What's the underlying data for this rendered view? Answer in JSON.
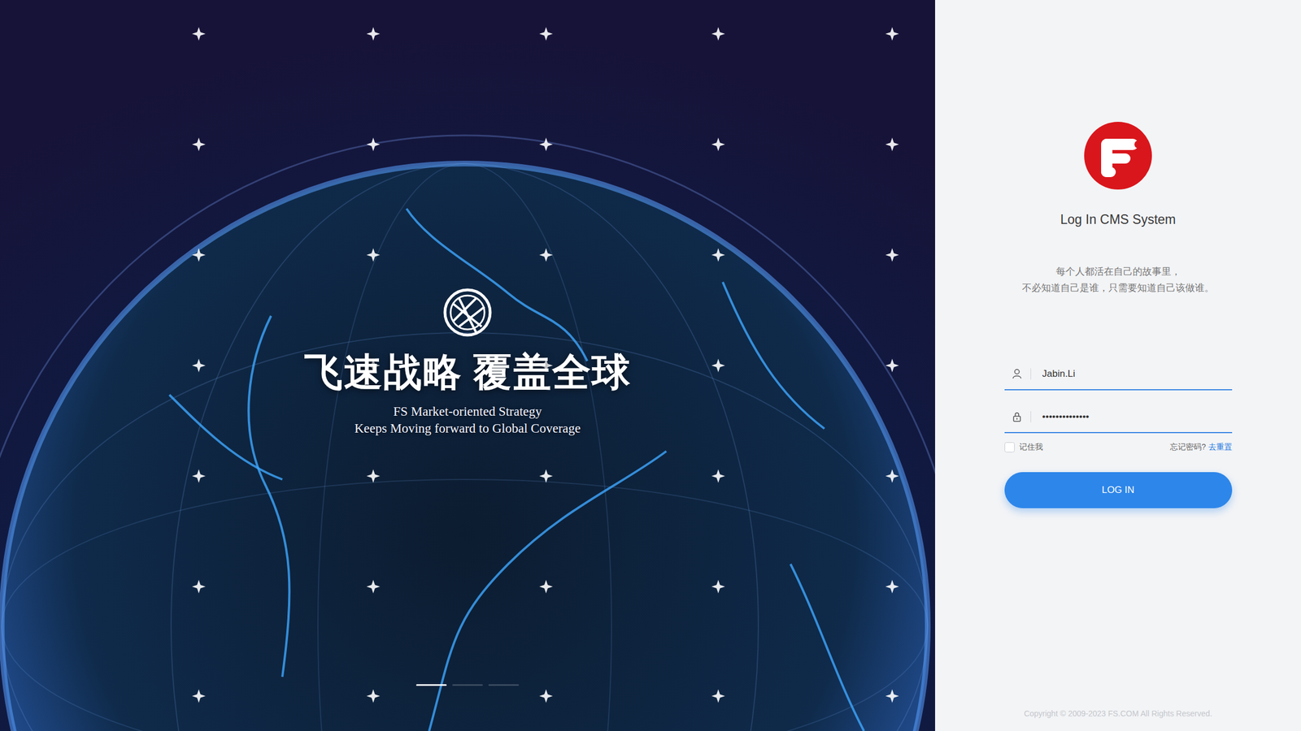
{
  "banner": {
    "headline": "飞速战略 覆盖全球",
    "subtitle_lines": [
      "FS Market-oriented Strategy",
      "Keeps Moving forward to Global Coverage"
    ],
    "slides": [
      {
        "selected": true
      },
      {
        "selected": false
      },
      {
        "selected": false
      }
    ]
  },
  "login": {
    "title": "Log In CMS System",
    "quote_lines": [
      "每个人都活在自己的故事里，",
      "不必知道自己是谁，只需要知道自己该做谁。"
    ],
    "username": "Jabin.Li",
    "password": "••••••••••••••",
    "remember": {
      "label": "记住我",
      "checked": false
    },
    "forgot": {
      "text": "忘记密码?",
      "link": "去重置"
    },
    "button": "LOG IN"
  },
  "footer": "Copyright © 2009-2023 FS.COM All Rights Reserved."
}
